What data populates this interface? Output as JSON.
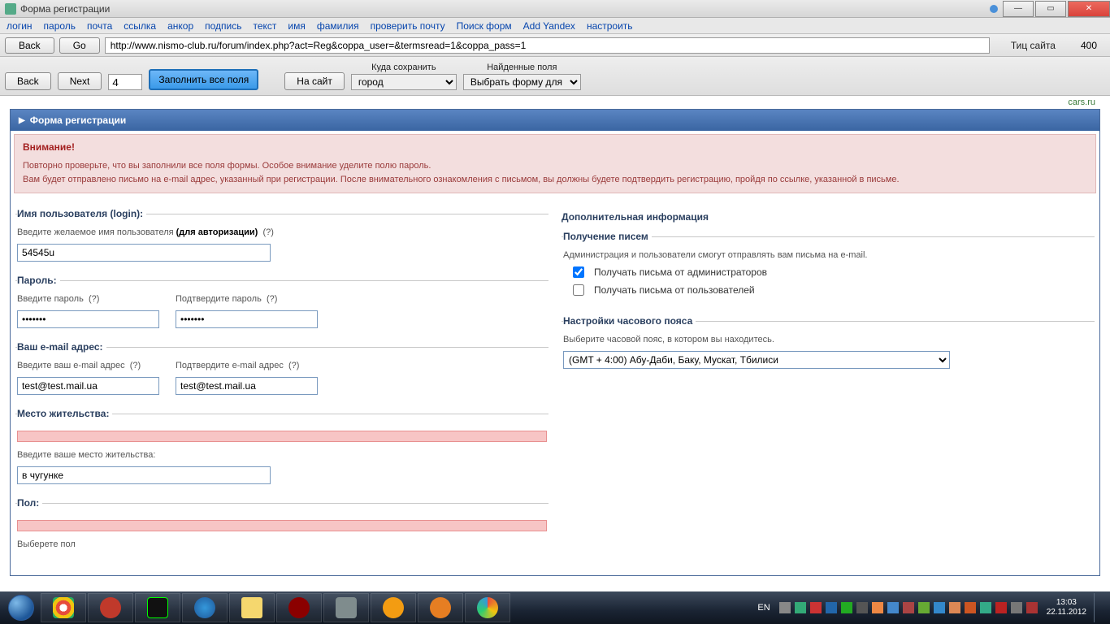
{
  "window": {
    "title": "Форма регистрации",
    "tab2": ""
  },
  "menu": {
    "login": "логин",
    "password": "пароль",
    "mail": "почта",
    "link": "ссылка",
    "anchor": "анкор",
    "caption": "подпись",
    "text": "текст",
    "name": "имя",
    "surname": "фамилия",
    "checkmail": "проверить почту",
    "findforms": "Поиск форм",
    "addyandex": "Add Yandex",
    "settings": "настроить"
  },
  "toolbar": {
    "back": "Back",
    "go": "Go",
    "url": "http://www.nismo-club.ru/forum/index.php?act=Reg&coppa_user=&termsread=1&coppa_pass=1",
    "tic_label": "Тиц сайта",
    "tic_value": "400"
  },
  "subbar": {
    "back": "Back",
    "next": "Next",
    "num": "4",
    "fill": "Заполнить все поля",
    "tosite": "На сайт",
    "save_label": "Куда сохранить",
    "save_value": "город",
    "found_label": "Найденные поля",
    "found_value": "Выбрать форму для сох"
  },
  "extlink": "cars.ru",
  "panel": {
    "title": "Форма регистрации"
  },
  "alert": {
    "title": "Внимание!",
    "line1": "Повторно проверьте, что вы заполнили все поля формы. Особое внимание уделите полю пароль.",
    "line2": "Вам будет отправлено письмо на e-mail адрес, указанный при регистрации. После внимательного ознакомления с письмом, вы должны будете подтвердить регистрацию, пройдя по ссылке, указанной в письме."
  },
  "f_user": {
    "legend": "Имя пользователя (login):",
    "hint1": "Введите желаемое имя пользователя ",
    "hint2": "(для авторизации)",
    "q": "(?)",
    "value": "54545u"
  },
  "f_pass": {
    "legend": "Пароль:",
    "lbl1": "Введите пароль",
    "lbl2": "Подтвердите пароль",
    "q": "(?)",
    "v1": "•••••••",
    "v2": "•••••••"
  },
  "f_mail": {
    "legend": "Ваш e-mail адрес:",
    "lbl1": "Введите ваш e-mail адрес",
    "lbl2": "Подтвердите e-mail адрес",
    "q": "(?)",
    "v1": "test@test.mail.ua",
    "v2": "test@test.mail.ua"
  },
  "f_loc": {
    "legend": "Место жительства:",
    "hint": "Введите ваше место жительства:",
    "value": "в чугунке"
  },
  "f_sex": {
    "legend": "Пол:",
    "hint": "Выберете пол"
  },
  "right": {
    "title": "Дополнительная информация",
    "g1_legend": "Получение писем",
    "g1_hint": "Администрация и пользователи смогут отправлять вам письма на e-mail.",
    "c1": "Получать письма от администраторов",
    "c2": "Получать письма от пользователей",
    "g2_legend": "Настройки часового пояса",
    "g2_hint": "Выберите часовой пояс, в котором вы находитесь.",
    "tz": "(GMT + 4:00) Абу-Даби, Баку, Мускат, Тбилиси"
  },
  "tray": {
    "lang": "EN",
    "time": "13:03",
    "date": "22.11.2012"
  }
}
